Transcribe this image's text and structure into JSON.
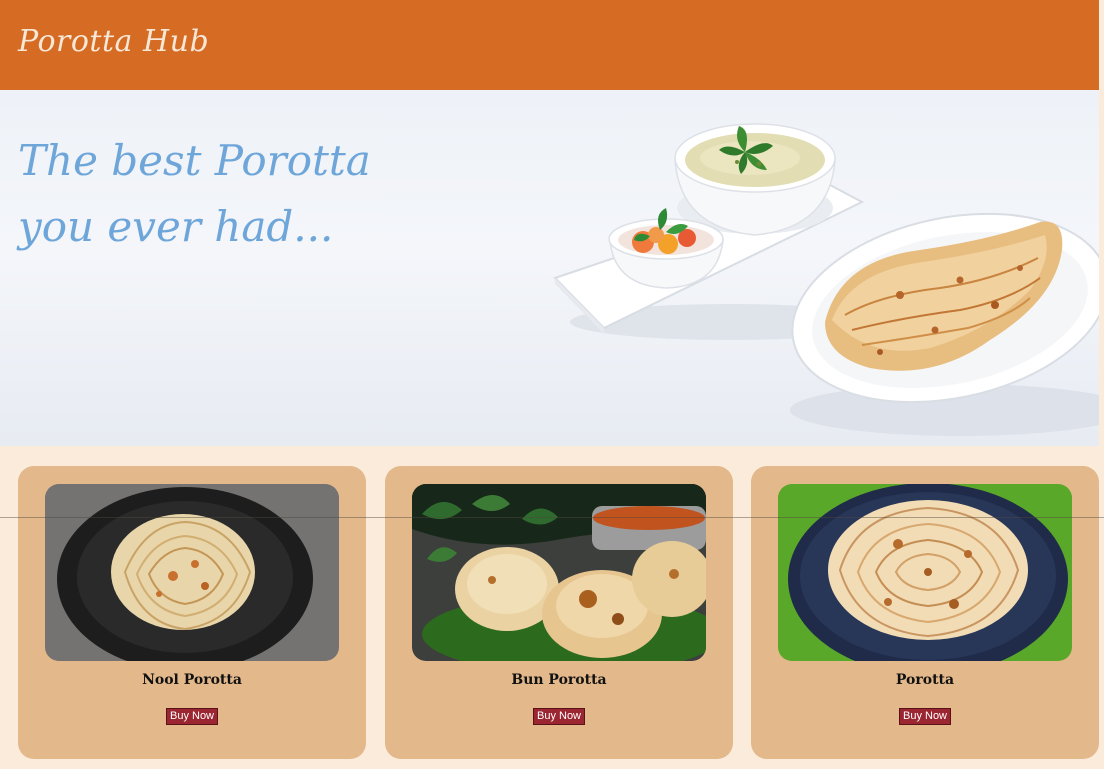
{
  "header": {
    "brand": "Porotta Hub",
    "background_color": "#d66b24"
  },
  "hero": {
    "line1": "The best Porotta",
    "line2": "you ever had...",
    "text_color": "#6fa6d9",
    "image": "porotta-with-curry-plate"
  },
  "products": [
    {
      "name": "Nool Porotta",
      "button_label": "Buy Now",
      "image": "nool-porotta-photo"
    },
    {
      "name": "Bun Porotta",
      "button_label": "Buy Now",
      "image": "bun-porotta-photo"
    },
    {
      "name": "Porotta",
      "button_label": "Buy Now",
      "image": "porotta-photo"
    }
  ],
  "colors": {
    "page_background": "#fbebdb",
    "card_background": "#e3b88b",
    "button_background": "#9b2531"
  }
}
